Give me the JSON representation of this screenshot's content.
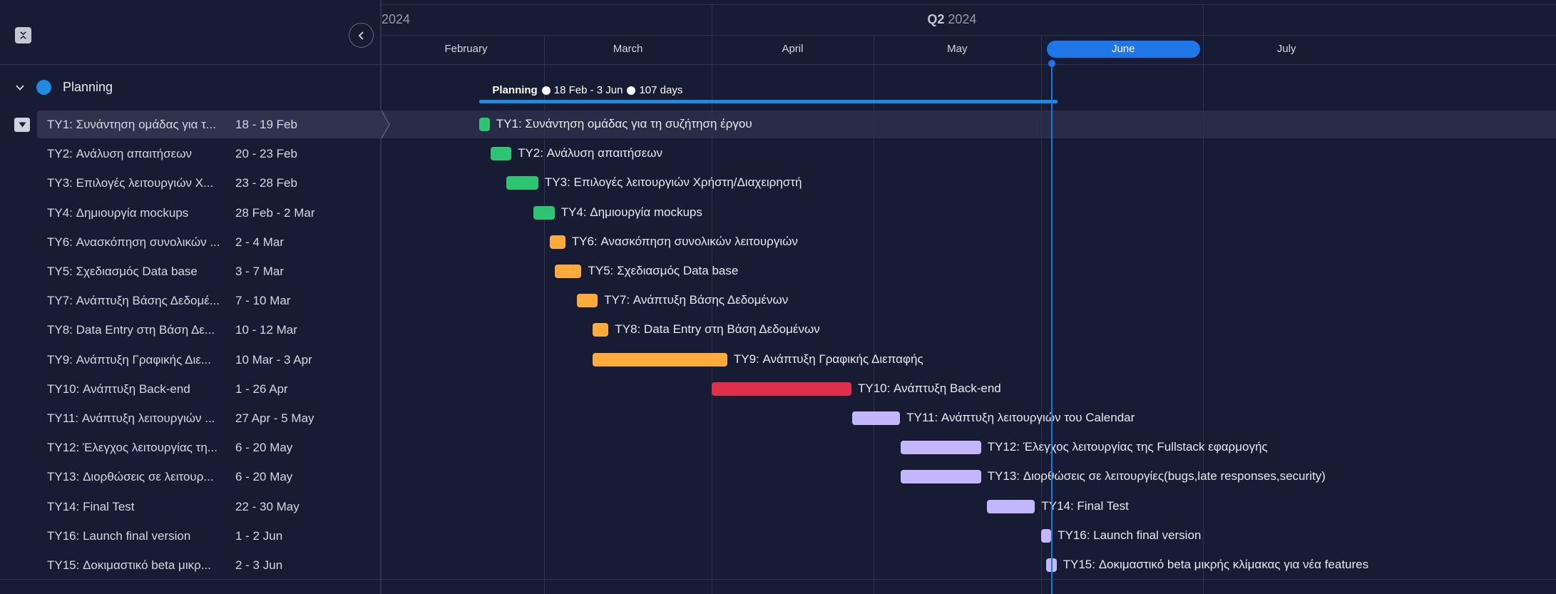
{
  "colors": {
    "background": "#181b34",
    "group": "#1f8ae0",
    "today": "#1f76e8",
    "green": "#2ec572",
    "orange": "#fdab3d",
    "red": "#df2f4a",
    "lavender": "#c3b6fb"
  },
  "icons": {
    "collapse_all": "collapse-all-icon",
    "collapse_panel": "chevron-left-icon",
    "group_toggle": "chevron-down-icon",
    "row_menu": "caret-down-icon"
  },
  "timeline": {
    "quarters": [
      {
        "label_bold": "",
        "year": "2024"
      },
      {
        "label_bold": "Q2",
        "year": "2024"
      }
    ],
    "months": [
      {
        "label": "February",
        "current": false
      },
      {
        "label": "March",
        "current": false
      },
      {
        "label": "April",
        "current": false
      },
      {
        "label": "May",
        "current": false
      },
      {
        "label": "June",
        "current": true
      },
      {
        "label": "July",
        "current": false
      }
    ],
    "summary": {
      "name": "Planning",
      "range": "18 Feb - 3 Jun",
      "duration": "107 days"
    }
  },
  "group": {
    "title": "Planning"
  },
  "tasks": [
    {
      "name": "TY1: Συνάντηση ομάδας για τη συζήτηση έργου",
      "list_name": "TY1: Συνάντηση ομάδας για τ...",
      "dates": "18 - 19 Feb",
      "color": "green",
      "start": "2024-02-18",
      "end": "2024-02-19"
    },
    {
      "name": "TY2: Ανάλυση απαιτήσεων",
      "list_name": "TY2: Ανάλυση απαιτήσεων",
      "dates": "20 - 23 Feb",
      "color": "green",
      "start": "2024-02-20",
      "end": "2024-02-23"
    },
    {
      "name": "TY3: Επιλογές λειτουργιών Χρήστη/Διαχειρηστή",
      "list_name": "TY3: Επιλογές λειτουργιών Χ...",
      "dates": "23 - 28 Feb",
      "color": "green",
      "start": "2024-02-23",
      "end": "2024-02-28"
    },
    {
      "name": "TY4: Δημιουργία mockups",
      "list_name": "TY4: Δημιουργία mockups",
      "dates": "28 Feb - 2 Mar",
      "color": "green",
      "start": "2024-02-28",
      "end": "2024-03-02"
    },
    {
      "name": "TY6: Ανασκόπηση συνολικών λειτουργιών",
      "list_name": "TY6: Ανασκόπηση συνολικών ...",
      "dates": "2 - 4 Mar",
      "color": "orange",
      "start": "2024-03-02",
      "end": "2024-03-04"
    },
    {
      "name": "TY5: Σχεδιασμός Data base",
      "list_name": "TY5: Σχεδιασμός Data base",
      "dates": "3 - 7 Mar",
      "color": "orange",
      "start": "2024-03-03",
      "end": "2024-03-07"
    },
    {
      "name": "TY7: Ανάπτυξη Βάσης Δεδομένων",
      "list_name": "TY7: Ανάπτυξη Βάσης Δεδομέ...",
      "dates": "7 - 10 Mar",
      "color": "orange",
      "start": "2024-03-07",
      "end": "2024-03-10"
    },
    {
      "name": "TY8: Data Entry στη Βάση Δεδομένων",
      "list_name": "TY8: Data Entry στη Βάση Δε...",
      "dates": "10 - 12 Mar",
      "color": "orange",
      "start": "2024-03-10",
      "end": "2024-03-12"
    },
    {
      "name": "TY9: Ανάπτυξη Γραφικής Διεπαφής",
      "list_name": "TY9: Ανάπτυξη Γραφικής Διε...",
      "dates": "10 Mar - 3 Apr",
      "color": "orange",
      "start": "2024-03-10",
      "end": "2024-04-03"
    },
    {
      "name": "TY10: Ανάπτυξη Back-end",
      "list_name": "TY10: Ανάπτυξη Back-end",
      "dates": "1 - 26 Apr",
      "color": "red",
      "start": "2024-04-01",
      "end": "2024-04-26"
    },
    {
      "name": "TY11: Ανάπτυξη λειτουργιών του Calendar",
      "list_name": "TY11: Ανάπτυξη λειτουργιών ...",
      "dates": "27 Apr - 5 May",
      "color": "lavender",
      "start": "2024-04-27",
      "end": "2024-05-05"
    },
    {
      "name": "TY12: Έλεγχος λειτουργίας της Fullstack εφαρμογής",
      "list_name": "TY12: Έλεγχος λειτουργίας τη...",
      "dates": "6 - 20 May",
      "color": "lavender",
      "start": "2024-05-06",
      "end": "2024-05-20"
    },
    {
      "name": "TY13: Διορθώσεις σε λειτουργίες(bugs,late responses,security)",
      "list_name": "TY13: Διορθώσεις σε λειτουρ...",
      "dates": "6 - 20 May",
      "color": "lavender",
      "start": "2024-05-06",
      "end": "2024-05-20"
    },
    {
      "name": "TY14: Final Test",
      "list_name": "TY14: Final Test",
      "dates": "22 - 30 May",
      "color": "lavender",
      "start": "2024-05-22",
      "end": "2024-05-30"
    },
    {
      "name": "TY16: Launch final version",
      "list_name": "TY16: Launch final version",
      "dates": "1 - 2 Jun",
      "color": "lavender",
      "start": "2024-06-01",
      "end": "2024-06-02"
    },
    {
      "name": "TY15: Δοκιμαστικό beta μικρής κλίμακας για νέα features",
      "list_name": "TY15: Δοκιμαστικό beta μικρ...",
      "dates": "2 - 3 Jun",
      "color": "lavender",
      "start": "2024-06-02",
      "end": "2024-06-03"
    }
  ],
  "selected_task_index": 0,
  "today": "2024-06-03"
}
